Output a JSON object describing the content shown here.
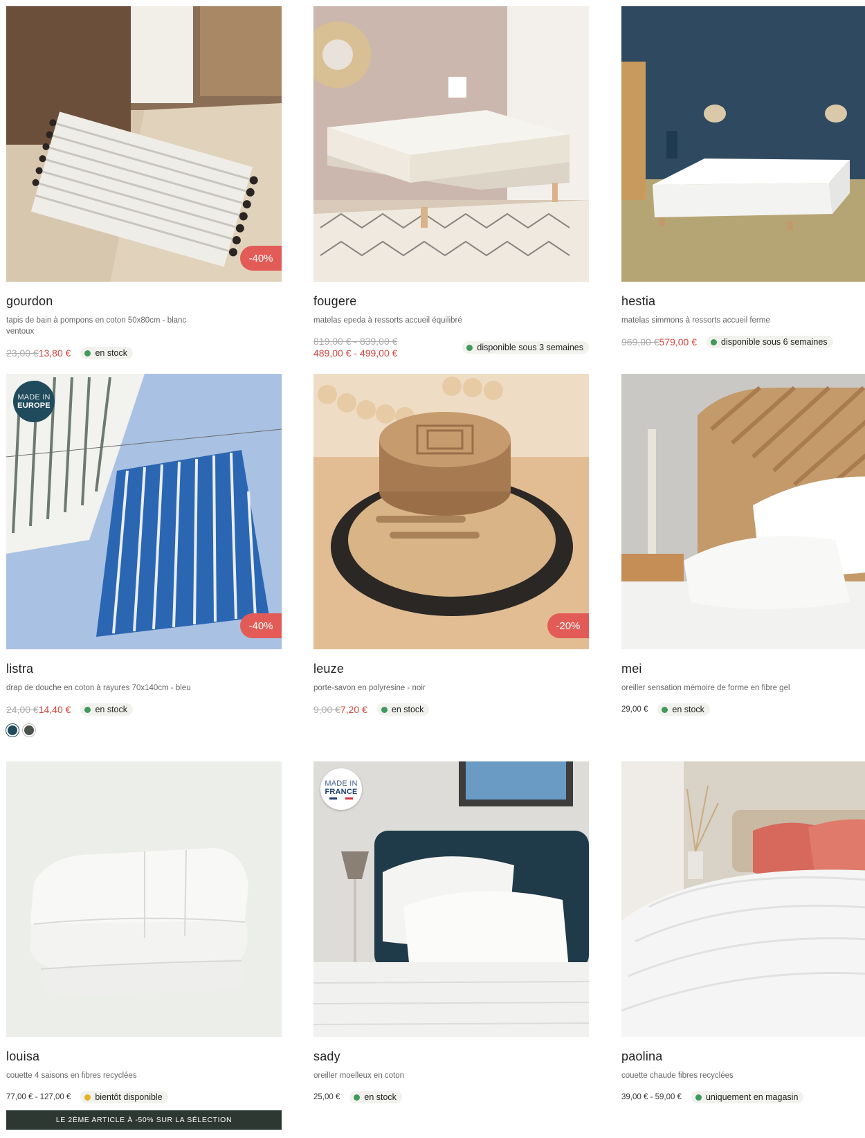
{
  "products": [
    {
      "name": "gourdon",
      "description": "tapis de bain à pompons en coton 50x80cm - blanc ventoux",
      "old_price": "23,00 €",
      "price": "13,80 €",
      "status": "en stock",
      "discount": "-40%"
    },
    {
      "name": "fougere",
      "description": "matelas epeda à ressorts accueil équilibré",
      "old_price": "819,00 € - 839,00 €",
      "price": "489,00 € - 499,00 €",
      "status": "disponible sous 3 semaines"
    },
    {
      "name": "hestia",
      "description": "matelas simmons à ressorts accueil ferme",
      "old_price": "969,00 €",
      "price": "579,00 €",
      "status": "disponible sous 6 semaines"
    },
    {
      "name": "listra",
      "description": "drap de douche en coton à rayures 70x140cm - bleu",
      "old_price": "24,00 €",
      "price": "14,40 €",
      "status": "en stock",
      "discount": "-40%",
      "badge_top": "MADE IN",
      "badge_bottom": "EUROPE",
      "swatch_colors": [
        "#1f4b5c",
        "#4a524c"
      ]
    },
    {
      "name": "leuze",
      "description": "porte-savon en polyresine - noir",
      "old_price": "9,00 €",
      "price": "7,20 €",
      "status": "en stock",
      "discount": "-20%"
    },
    {
      "name": "mei",
      "description": "oreiller sensation mémoire de forme en fibre gel",
      "price": "29,00 €",
      "status": "en stock"
    },
    {
      "name": "louisa",
      "description": "couette 4 saisons en fibres recyclées",
      "price": "77,00 € - 127,00 €",
      "status": "bientôt disponible",
      "promo": "LE 2ÈME ARTICLE À -50% SUR LA SÉLECTION"
    },
    {
      "name": "sady",
      "description": "oreiller moelleux en coton",
      "price": "25,00 €",
      "status": "en stock",
      "badge_top": "MADE IN",
      "badge_bottom": "FRANCE"
    },
    {
      "name": "paolina",
      "description": "couette chaude fibres recyclées",
      "price": "39,00 € - 59,00 €",
      "status": "uniquement en magasin"
    }
  ],
  "colors": {
    "in_stock": "#3f9a5c",
    "soon": "#e5b321",
    "discount": "#e35b57",
    "sale_price": "#d2463f",
    "promo_bar": "#2e3833"
  }
}
